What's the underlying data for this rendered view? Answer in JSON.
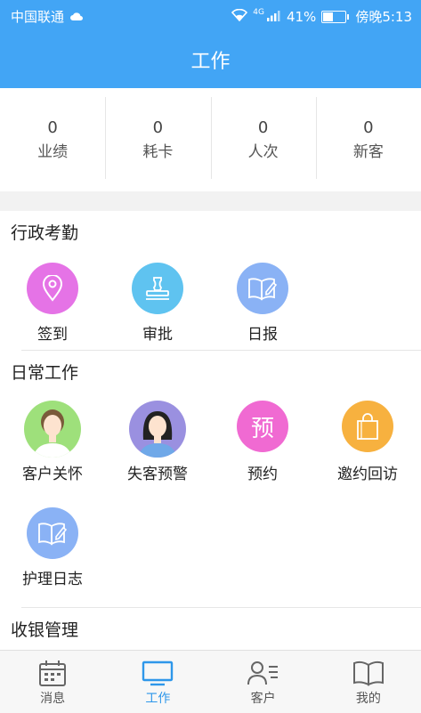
{
  "status_bar": {
    "carrier": "中国联通",
    "cloud_icon": "cloud-icon",
    "wifi_icon": "wifi-icon",
    "network": "4G",
    "battery_percent": "41%",
    "battery_level": 0.41,
    "time": "傍晚5:13"
  },
  "header": {
    "title": "工作"
  },
  "stats": [
    {
      "value": "0",
      "label": "业绩"
    },
    {
      "value": "0",
      "label": "耗卡"
    },
    {
      "value": "0",
      "label": "人次"
    },
    {
      "value": "0",
      "label": "新客"
    }
  ],
  "sections": {
    "admin": {
      "title": "行政考勤",
      "items": [
        {
          "label": "签到",
          "icon": "location-pin-icon",
          "color": "#e573e6"
        },
        {
          "label": "审批",
          "icon": "stamp-icon",
          "color": "#5fc3f0"
        },
        {
          "label": "日报",
          "icon": "notebook-pencil-icon",
          "color": "#8ab2f5"
        }
      ]
    },
    "daily": {
      "title": "日常工作",
      "items": [
        {
          "label": "客户关怀",
          "icon": "woman-avatar-icon",
          "color": "#9ee07b"
        },
        {
          "label": "失客预警",
          "icon": "woman-dark-hair-avatar-icon",
          "color": "#9a90e0"
        },
        {
          "label": "预约",
          "icon_text": "预",
          "color": "#f06ad2"
        },
        {
          "label": "邀约回访",
          "icon": "shopping-bag-icon",
          "color": "#f7b13f"
        },
        {
          "label": "护理日志",
          "icon": "notebook-pencil-icon",
          "color": "#8ab2f5"
        }
      ]
    },
    "cashier": {
      "title": "收银管理"
    }
  },
  "tabbar": {
    "active_color": "#2e97ea",
    "tabs": [
      {
        "label": "消息",
        "icon": "calendar-icon"
      },
      {
        "label": "工作",
        "icon": "monitor-icon",
        "active": true
      },
      {
        "label": "客户",
        "icon": "contacts-icon"
      },
      {
        "label": "我的",
        "icon": "open-book-icon"
      }
    ]
  },
  "colors": {
    "primary": "#42a5f5",
    "background": "#f2f2f2"
  }
}
